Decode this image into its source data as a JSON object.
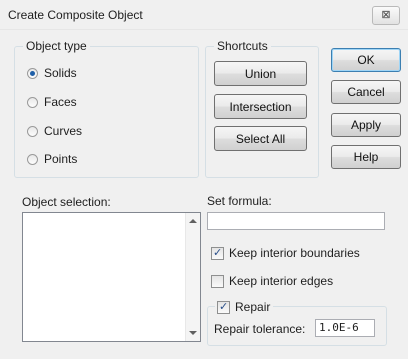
{
  "window": {
    "title": "Create Composite Object",
    "close_label": "⊠"
  },
  "object_type": {
    "label": "Object type",
    "options": [
      {
        "label": "Solids",
        "checked": true
      },
      {
        "label": "Faces",
        "checked": false
      },
      {
        "label": "Curves",
        "checked": false
      },
      {
        "label": "Points",
        "checked": false
      }
    ]
  },
  "shortcuts": {
    "label": "Shortcuts",
    "buttons": [
      "Union",
      "Intersection",
      "Select All"
    ]
  },
  "actions": {
    "ok": "OK",
    "cancel": "Cancel",
    "apply": "Apply",
    "help": "Help"
  },
  "object_selection": {
    "label": "Object selection:"
  },
  "formula": {
    "label": "Set formula:",
    "value": ""
  },
  "options": {
    "keep_interior_boundaries": {
      "label": "Keep interior boundaries",
      "checked": true
    },
    "keep_interior_edges": {
      "label": "Keep interior edges",
      "checked": false
    }
  },
  "repair": {
    "label": "Repair",
    "checked": true,
    "tolerance_label": "Repair tolerance:",
    "tolerance_value": "1.0E-6"
  }
}
